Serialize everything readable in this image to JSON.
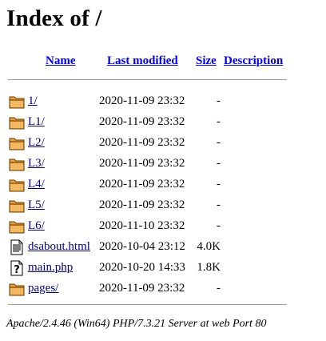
{
  "page": {
    "title": "Index of /"
  },
  "columns": {
    "name": "Name",
    "last_modified": "Last modified",
    "size": "Size",
    "description": "Description"
  },
  "rows": [
    {
      "name": "1/",
      "modified": "2020-11-09 23:32",
      "size": "-",
      "icon": "folder-icon"
    },
    {
      "name": "L1/",
      "modified": "2020-11-09 23:32",
      "size": "-",
      "icon": "folder-icon"
    },
    {
      "name": "L2/",
      "modified": "2020-11-09 23:32",
      "size": "-",
      "icon": "folder-icon"
    },
    {
      "name": "L3/",
      "modified": "2020-11-09 23:32",
      "size": "-",
      "icon": "folder-icon"
    },
    {
      "name": "L4/",
      "modified": "2020-11-09 23:32",
      "size": "-",
      "icon": "folder-icon"
    },
    {
      "name": "L5/",
      "modified": "2020-11-09 23:32",
      "size": "-",
      "icon": "folder-icon"
    },
    {
      "name": "L6/",
      "modified": "2020-11-10 23:32",
      "size": "-",
      "icon": "folder-icon"
    },
    {
      "name": "dsabout.html",
      "modified": "2020-10-04 23:12",
      "size": "4.0K",
      "icon": "text-file-icon"
    },
    {
      "name": "main.php",
      "modified": "2020-10-20 14:33",
      "size": "1.8K",
      "icon": "unknown-file-icon"
    },
    {
      "name": "pages/",
      "modified": "2020-11-09 23:32",
      "size": "-",
      "icon": "folder-icon"
    }
  ],
  "footer": {
    "address": "Apache/2.4.46 (Win64) PHP/7.3.21 Server at web Port 80"
  },
  "colors": {
    "link_visited": "#000080",
    "link_header": "#0000ee",
    "folder_fill": "#e8a040",
    "folder_outline": "#6a3a00"
  }
}
